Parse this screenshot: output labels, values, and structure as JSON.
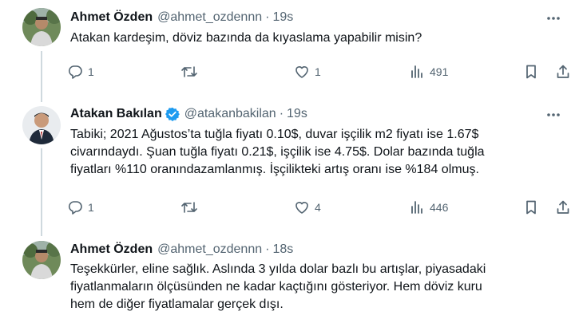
{
  "tweets": [
    {
      "name": "Ahmet Özden",
      "handle": "@ahmet_ozdennn",
      "dot": "·",
      "time": "19s",
      "lines": [
        "Atakan kardeşim, döviz bazında da kıyaslama yapabilir misin?"
      ],
      "replies": "1",
      "retweets": "",
      "likes": "1",
      "views": "491",
      "avatar_icon": "person-outdoor-photo"
    },
    {
      "name": "Atakan Bakılan",
      "handle": "@atakanbakilan",
      "dot": "·",
      "time": "19s",
      "verified": true,
      "lines": [
        "Tabiki; 2021 Ağustos’ta tuğla fiyatı 0.10$, duvar işçilik m2 fiyatı ise 1.67$",
        "civarındaydı. Şuan tuğla fiyatı 0.21$, işçilik ise 4.75$. Dolar bazında tuğla",
        "fiyatları %110 oranındazamlanmış. İşçilikteki artış oranı ise %184 olmuş."
      ],
      "replies": "1",
      "retweets": "",
      "likes": "4",
      "views": "446",
      "avatar_icon": "person-suit-portrait"
    },
    {
      "name": "Ahmet Özden",
      "handle": "@ahmet_ozdennn",
      "dot": "·",
      "time": "18s",
      "lines": [
        "Teşekkürler, eline sağlık. Aslında 3 yılda dolar bazlı bu artışlar, piyasadaki",
        "fiyatlanmaların ölçüsünden ne kadar kaçtığını gösteriyor. Hem döviz kuru",
        "hem de diğer fiyatlamalar gerçek dışı."
      ],
      "avatar_icon": "person-outdoor-photo"
    }
  ],
  "colors": {
    "text": "#0f1419",
    "muted": "#536471",
    "thread_line": "#cfd9de",
    "verified": "#1d9bf0"
  }
}
